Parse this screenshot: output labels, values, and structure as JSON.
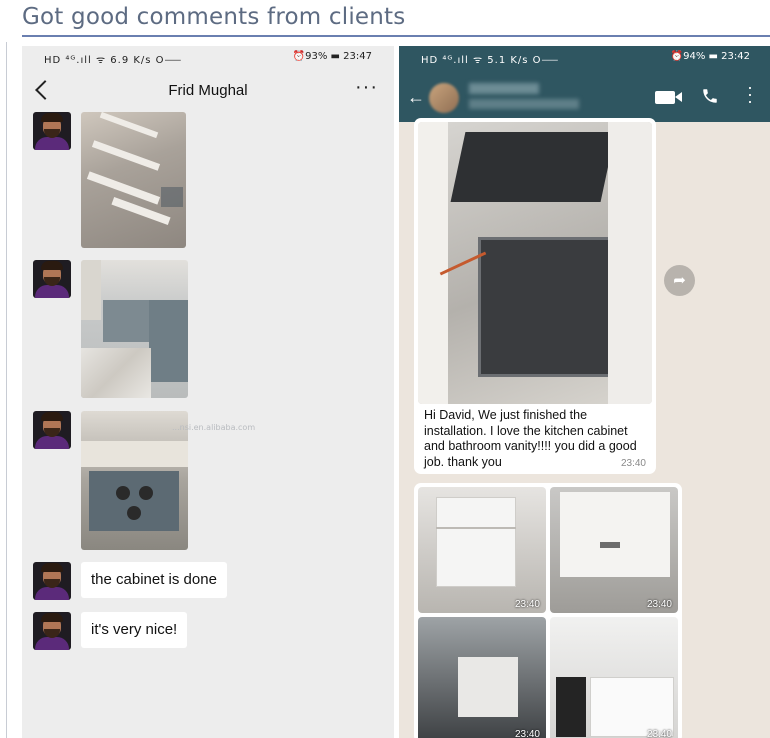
{
  "page": {
    "heading": "Got good comments from clients"
  },
  "left_phone": {
    "status_left": "HD ⁴ᴳ.ıll ᯤ 6.9 K/s O⸺",
    "status_right": "⏰93% ▬ 23:47",
    "contact_name": "Frid Mughal",
    "back_icon": "chevron-left-icon",
    "more_icon": "more-horizontal-icon",
    "messages": [
      {
        "type": "image",
        "subject": "cabinet drawers"
      },
      {
        "type": "image",
        "subject": "vanity cabinet"
      },
      {
        "type": "image",
        "subject": "open cabinet drawer"
      },
      {
        "type": "text",
        "text": "the cabinet is done"
      },
      {
        "type": "text",
        "text": "it's very nice!"
      }
    ],
    "watermark": "...nsi.en.alibaba.com"
  },
  "right_phone": {
    "status_left": "HD ⁴ᴳ.ıll ᯤ 5.1 K/s O⸺",
    "status_right": "⏰94% ▬ 23:42",
    "back_icon": "arrow-left-icon",
    "video_icon": "video-call-icon",
    "phone_icon": "phone-icon",
    "menu_icon": "more-vertical-icon",
    "share_icon": "forward-icon",
    "message": {
      "text": "Hi David, We just finished the installation. I love the kitchen cabinet and bathroom vanity!!!! you did a good job. thank you",
      "time": "23:40"
    },
    "thumb_times": [
      "23:40",
      "23:40",
      "23:40",
      "23:40"
    ]
  },
  "colors": {
    "heading_text": "#5d6b82",
    "heading_rule": "#6a7fb0",
    "whatsapp_bar": "#2f5661",
    "chat_bg_left": "#ededed",
    "chat_bg_right": "#ece5dd"
  }
}
